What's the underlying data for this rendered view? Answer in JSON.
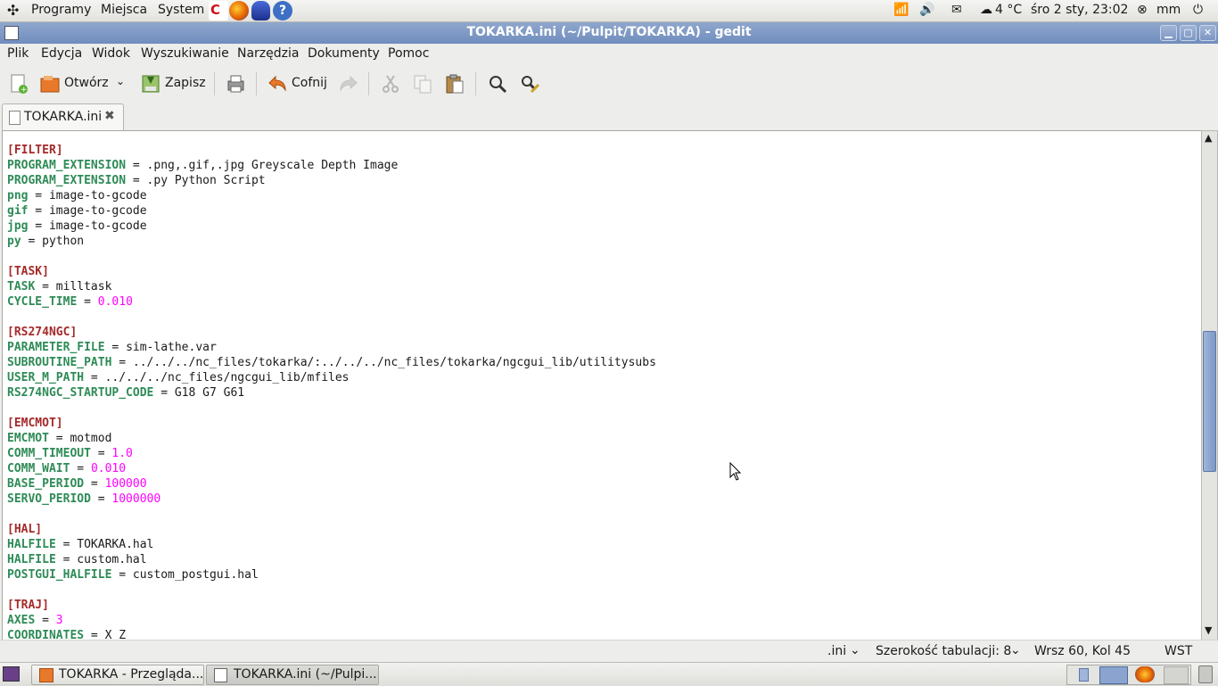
{
  "top_panel": {
    "menus": [
      "Programy",
      "Miejsca",
      "System"
    ],
    "weather": "4 °C",
    "clock": "śro  2 sty, 23:02",
    "user": "mm"
  },
  "window": {
    "title": "TOKARKA.ini (~/Pulpit/TOKARKA) - gedit"
  },
  "menubar": [
    "Plik",
    "Edycja",
    "Widok",
    "Wyszukiwanie",
    "Narzędzia",
    "Dokumenty",
    "Pomoc"
  ],
  "toolbar": {
    "open_label": "Otwórz",
    "save_label": "Zapisz",
    "undo_label": "Cofnij"
  },
  "tab": {
    "label": "TOKARKA.ini"
  },
  "editor": {
    "lines": [
      {
        "t": "sec",
        "s": "[FILTER]"
      },
      {
        "t": "kv",
        "k": "PROGRAM_EXTENSION",
        "v": ".png,.gif,.jpg Greyscale Depth Image"
      },
      {
        "t": "kv",
        "k": "PROGRAM_EXTENSION",
        "v": ".py Python Script"
      },
      {
        "t": "kv",
        "k": "png",
        "v": "image-to-gcode"
      },
      {
        "t": "kv",
        "k": "gif",
        "v": "image-to-gcode"
      },
      {
        "t": "kv",
        "k": "jpg",
        "v": "image-to-gcode"
      },
      {
        "t": "kv",
        "k": "py",
        "v": "python"
      },
      {
        "t": "blank"
      },
      {
        "t": "sec",
        "s": "[TASK]"
      },
      {
        "t": "kv",
        "k": "TASK",
        "v": "milltask"
      },
      {
        "t": "kvn",
        "k": "CYCLE_TIME",
        "v": "0.010"
      },
      {
        "t": "blank"
      },
      {
        "t": "sec",
        "s": "[RS274NGC]"
      },
      {
        "t": "kv",
        "k": "PARAMETER_FILE",
        "v": "sim-lathe.var"
      },
      {
        "t": "kv",
        "k": "SUBROUTINE_PATH",
        "v": "../../../nc_files/tokarka/:../../../nc_files/tokarka/ngcgui_lib/utilitysubs"
      },
      {
        "t": "kv",
        "k": "USER_M_PATH",
        "v": "../../../nc_files/ngcgui_lib/mfiles"
      },
      {
        "t": "kv",
        "k": "RS274NGC_STARTUP_CODE",
        "v": "G18 G7 G61"
      },
      {
        "t": "blank"
      },
      {
        "t": "sec",
        "s": "[EMCMOT]"
      },
      {
        "t": "kv",
        "k": "EMCMOT",
        "v": "motmod"
      },
      {
        "t": "kvn",
        "k": "COMM_TIMEOUT",
        "v": "1.0"
      },
      {
        "t": "kvn",
        "k": "COMM_WAIT",
        "v": "0.010"
      },
      {
        "t": "kvn",
        "k": "BASE_PERIOD",
        "v": "100000"
      },
      {
        "t": "kvn",
        "k": "SERVO_PERIOD",
        "v": "1000000"
      },
      {
        "t": "blank"
      },
      {
        "t": "sec",
        "s": "[HAL]"
      },
      {
        "t": "kv",
        "k": "HALFILE",
        "v": "TOKARKA.hal"
      },
      {
        "t": "kv",
        "k": "HALFILE",
        "v": "custom.hal"
      },
      {
        "t": "kv",
        "k": "POSTGUI_HALFILE",
        "v": "custom_postgui.hal"
      },
      {
        "t": "blank"
      },
      {
        "t": "sec",
        "s": "[TRAJ]"
      },
      {
        "t": "kvn",
        "k": "AXES",
        "v": "3"
      },
      {
        "t": "kv",
        "k": "COORDINATES",
        "v": "X Z"
      }
    ]
  },
  "statusbar": {
    "language": ".ini",
    "tab_width": "Szerokość tabulacji:  8",
    "position": "Wrsz 60, Kol 45",
    "mode": "WST"
  },
  "taskbar": [
    {
      "label": "TOKARKA - Przegląda..."
    },
    {
      "label": "TOKARKA.ini (~/Pulpi..."
    }
  ],
  "colors": {
    "section": "#a52a2a",
    "key": "#2e8b57",
    "number": "#ff00ff",
    "titlebar": "#7d97c4"
  }
}
